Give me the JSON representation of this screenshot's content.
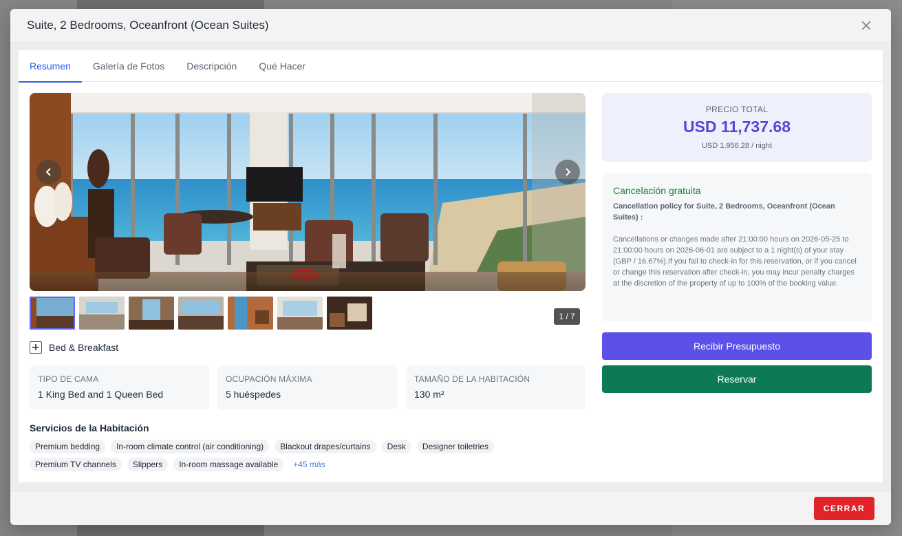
{
  "modal": {
    "title": "Suite, 2 Bedrooms, Oceanfront (Ocean Suites)"
  },
  "tabs": [
    {
      "label": "Resumen",
      "active": true
    },
    {
      "label": "Galería de Fotos",
      "active": false
    },
    {
      "label": "Descripción",
      "active": false
    },
    {
      "label": "Qué Hacer",
      "active": false
    }
  ],
  "gallery": {
    "counter": "1 / 7",
    "current_index": 1,
    "total": 7
  },
  "meal_plan": "Bed & Breakfast",
  "room_info": [
    {
      "label": "TIPO DE CAMA",
      "value": "1 King Bed and 1 Queen Bed"
    },
    {
      "label": "OCUPACIÓN MÁXIMA",
      "value": "5 huéspedes"
    },
    {
      "label": "TAMAÑO DE LA HABITACIÓN",
      "value": "130 m²"
    }
  ],
  "services": {
    "title": "Servicios de la Habitación",
    "items": [
      "Premium bedding",
      "In-room climate control (air conditioning)",
      "Blackout drapes/curtains",
      "Desk",
      "Designer toiletries",
      "Premium TV channels",
      "Slippers",
      "In-room massage available"
    ],
    "more": "+45 más"
  },
  "price": {
    "label": "PRECIO TOTAL",
    "total": "USD 11,737.68",
    "per_night": "USD 1,956.28 / night"
  },
  "cancellation": {
    "title": "Cancelación gratuita",
    "subtitle": "Cancellation policy for Suite, 2 Bedrooms, Oceanfront (Ocean Suites) :",
    "text": "Cancellations or changes made after 21:00:00 hours on 2026-05-25 to 21:00:00 hours on 2026-06-01 are subject to a 1 night(s) of your stay (GBP / 16.67%).If you fail to check-in for this reservation, or if you cancel or change this reservation after check-in, you may incur penalty charges at the discretion of the property of up to 100% of the booking value."
  },
  "buttons": {
    "quote": "Recibir Presupuesto",
    "book": "Reservar",
    "close": "CERRAR"
  },
  "colors": {
    "accent": "#2563eb",
    "price": "#5148d6",
    "quote_button": "#5b50e8",
    "book_button": "#0e7a55",
    "close_button": "#e0242a",
    "free_cancel": "#16803c"
  }
}
